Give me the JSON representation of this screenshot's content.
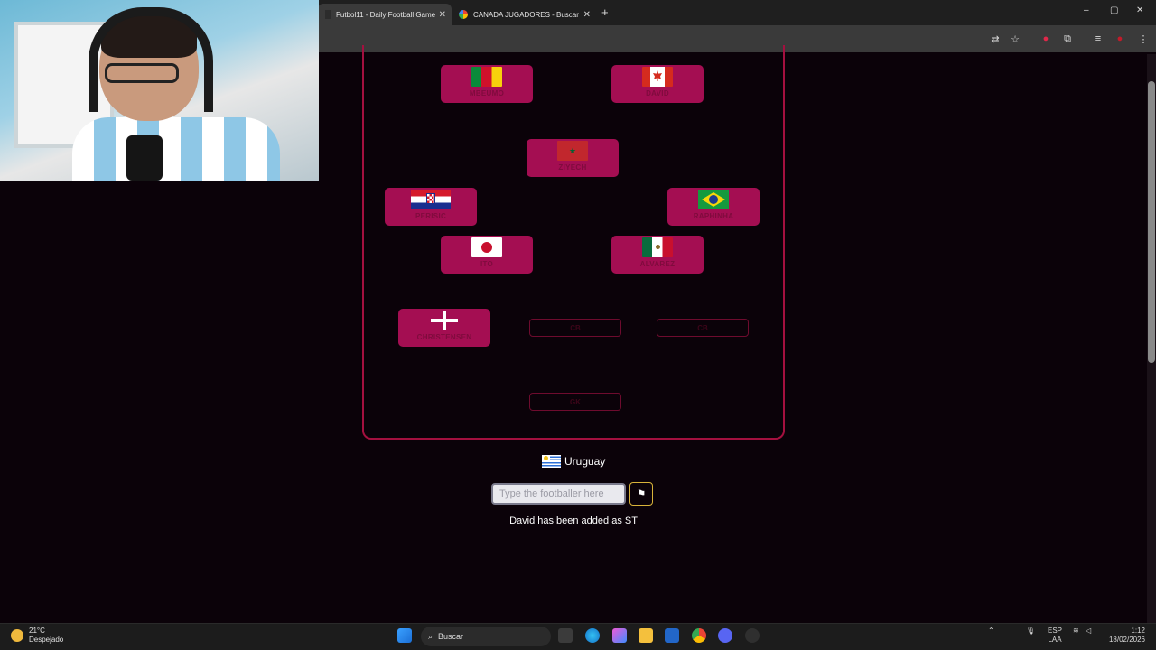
{
  "browser": {
    "tabs": [
      {
        "label": "Futbol11 - Daily Football Game",
        "active": true
      },
      {
        "label": "CANADA JUGADORES - Buscar",
        "active": false
      }
    ],
    "new_tab": "+",
    "window_controls": [
      "–",
      "▢",
      "✕"
    ]
  },
  "pitch": {
    "players": [
      {
        "name": "MBEUMO",
        "flag": "cameroon-flag"
      },
      {
        "name": "DAVID",
        "flag": "canada-flag"
      },
      {
        "name": "ZIYECH",
        "flag": "morocco-flag"
      },
      {
        "name": "PERISIC",
        "flag": "croatia-flag"
      },
      {
        "name": "RAPHINHA",
        "flag": "brazil-flag"
      },
      {
        "name": "ITO",
        "flag": "japan-flag"
      },
      {
        "name": "ALVAREZ",
        "flag": "mexico-flag"
      },
      {
        "name": "CHRISTENSEN",
        "flag": "denmark-flag"
      }
    ],
    "empty_slots": [
      "CB",
      "CB",
      "GK"
    ]
  },
  "game": {
    "country": "Uruguay",
    "search_placeholder": "Type the footballer here",
    "give_up_icon": "flag-icon",
    "status": "David has been added as ST"
  },
  "taskbar": {
    "temperature": "21°C",
    "weather": "Despejado",
    "search_label": "Buscar",
    "lang_top": "ESP",
    "lang_bottom": "LAA",
    "time": "1:12",
    "date": "18/02/2026"
  },
  "colors": {
    "background": "#0b0209",
    "card": "#a40e52",
    "pitch_border": "#a4103f",
    "accent": "#d8b33a"
  }
}
